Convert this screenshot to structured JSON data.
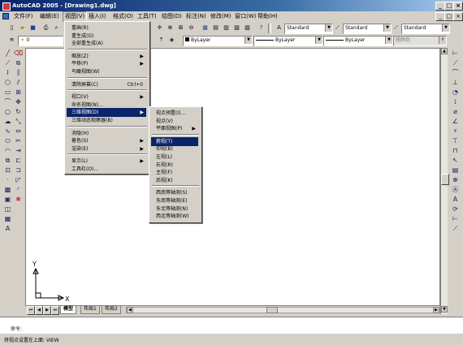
{
  "window": {
    "title": "AutoCAD 2005 - [Drawing1.dwg]",
    "controls": {
      "minimize": "_",
      "restore": "□",
      "close": "×"
    },
    "doc_controls": {
      "minimize": "_",
      "restore": "□",
      "close": "×"
    }
  },
  "menubar": [
    {
      "label": "文件(F)"
    },
    {
      "label": "编辑(E)"
    },
    {
      "label": "视图(V)"
    },
    {
      "label": "插入(I)"
    },
    {
      "label": "格式(O)"
    },
    {
      "label": "工具(T)"
    },
    {
      "label": "绘图(D)"
    },
    {
      "label": "标注(N)"
    },
    {
      "label": "修改(M)"
    },
    {
      "label": "窗口(W)"
    },
    {
      "label": "帮助(H)"
    }
  ],
  "toolbar": {
    "text_style": "Standard",
    "dim_style": "Standard",
    "table_style": "Standard",
    "layer": "0",
    "color": "ByLayer",
    "linetype": "ByLayer",
    "lineweight": "ByLayer",
    "plotstyle": "随颜色"
  },
  "view_menu": [
    {
      "label": "重画(R)"
    },
    {
      "label": "重生成(G)"
    },
    {
      "label": "全部重生成(A)"
    },
    {
      "sep": true
    },
    {
      "label": "缩放(Z)",
      "sub": "▶"
    },
    {
      "label": "平移(P)",
      "sub": "▶"
    },
    {
      "label": "鸟瞰视图(W)"
    },
    {
      "sep": true
    },
    {
      "label": "清除屏幕(C)",
      "shortcut": "Ctrl+0"
    },
    {
      "sep": true
    },
    {
      "label": "视口(V)",
      "sub": "▶"
    },
    {
      "label": "命名视图(N)..."
    },
    {
      "label": "三维视图(D)",
      "sub": "▶",
      "highlight": true
    },
    {
      "label": "三维动态观察器(B)"
    },
    {
      "sep": true
    },
    {
      "label": "消隐(H)"
    },
    {
      "label": "着色(S)",
      "sub": "▶"
    },
    {
      "label": "渲染(E)",
      "sub": "▶"
    },
    {
      "sep": true
    },
    {
      "label": "显示(L)",
      "sub": "▶"
    },
    {
      "label": "工具栏(O)..."
    }
  ],
  "view3d_menu": [
    {
      "label": "视点预置(I)..."
    },
    {
      "label": "视点(V)"
    },
    {
      "label": "平面视图(P)",
      "sub": "▶"
    },
    {
      "sep": true
    },
    {
      "label": "俯视(T)",
      "highlight": true
    },
    {
      "label": "仰视(B)"
    },
    {
      "label": "左视(L)"
    },
    {
      "label": "右视(R)"
    },
    {
      "label": "主视(F)"
    },
    {
      "label": "后视(K)"
    },
    {
      "sep": true
    },
    {
      "label": "西南等轴测(S)"
    },
    {
      "label": "东南等轴测(E)"
    },
    {
      "label": "东北等轴测(N)"
    },
    {
      "label": "西北等轴测(W)"
    }
  ],
  "layout_tabs": [
    {
      "label": "模型"
    },
    {
      "label": "布局1"
    },
    {
      "label": "布局2"
    }
  ],
  "ucs": {
    "x_label": "X",
    "y_label": "Y"
  },
  "command": {
    "history": "",
    "prompt": "命令:"
  },
  "status": {
    "text": "将视点设置在上面:  VIEW"
  }
}
